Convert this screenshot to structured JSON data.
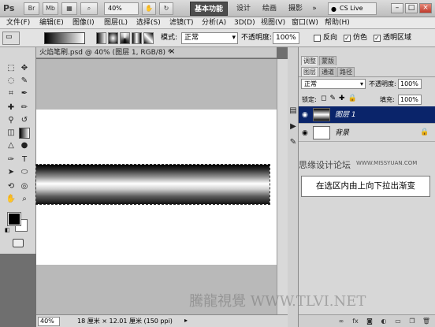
{
  "app": {
    "logo": "Ps",
    "bridge": "Br",
    "minibridge": "Mb",
    "zoom": "40%",
    "workspaces": [
      "基本功能",
      "设计",
      "绘画",
      "摄影"
    ],
    "more": "»",
    "cslive": "CS Live"
  },
  "menu": [
    "文件(F)",
    "编辑(E)",
    "图像(I)",
    "图层(L)",
    "选择(S)",
    "滤镜(T)",
    "分析(A)",
    "3D(D)",
    "视图(V)",
    "窗口(W)",
    "帮助(H)"
  ],
  "options": {
    "mode_label": "模式:",
    "mode_value": "正常",
    "opacity_label": "不透明度:",
    "opacity_value": "100%",
    "reverse_label": "反向",
    "dither_label": "仿色",
    "transparency_label": "透明区域"
  },
  "document": {
    "tab_title": "火焰笔刷.psd @ 40% (图层 1, RGB/8) *",
    "close": "×",
    "zoom": "40%",
    "info": "18 厘米 × 12.01 厘米 (150 ppi)"
  },
  "panel": {
    "tabs_top": [
      "调整",
      "蒙版"
    ],
    "tabs": [
      "图层",
      "通道",
      "路径"
    ],
    "blend_mode": "正常",
    "opacity_label": "不透明度:",
    "opacity_value": "100%",
    "lock_label": "锁定:",
    "fill_label": "填充:",
    "fill_value": "100%",
    "layers": [
      {
        "name": "图层 1",
        "selected": true
      },
      {
        "name": "背景",
        "selected": false
      }
    ],
    "watermark": "思缘设计论坛",
    "watermark_url": "WWW.MISSYUAN.COM",
    "callout": "在选区内由上向下拉出渐变"
  },
  "footer_watermark": "騰龍視覺 WWW.TLVI.NET"
}
